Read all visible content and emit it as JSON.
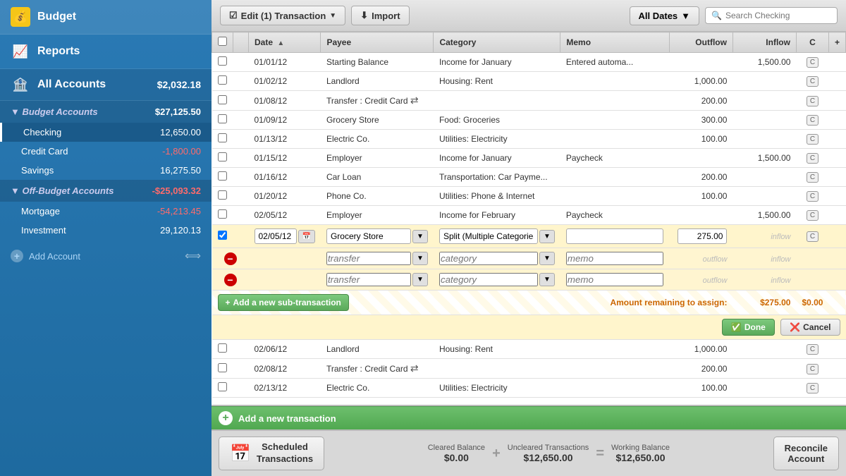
{
  "sidebar": {
    "budget_label": "Budget",
    "reports_label": "Reports",
    "all_accounts_label": "All Accounts",
    "all_accounts_balance": "$2,032.18",
    "budget_accounts_label": "Budget Accounts",
    "budget_accounts_balance": "$27,125.50",
    "off_budget_label": "Off-Budget Accounts",
    "off_budget_balance": "-$25,093.32",
    "accounts": [
      {
        "name": "Checking",
        "balance": "12,650.00",
        "active": true,
        "negative": false
      },
      {
        "name": "Credit Card",
        "balance": "-1,800.00",
        "active": false,
        "negative": true
      },
      {
        "name": "Savings",
        "balance": "16,275.50",
        "active": false,
        "negative": false
      }
    ],
    "off_budget_accounts": [
      {
        "name": "Mortgage",
        "balance": "-54,213.45",
        "active": false,
        "negative": true
      },
      {
        "name": "Investment",
        "balance": "29,120.13",
        "active": false,
        "negative": false
      }
    ],
    "add_account_label": "Add Account"
  },
  "toolbar": {
    "edit_transaction_label": "Edit (1) Transaction",
    "import_label": "Import",
    "all_dates_label": "All Dates",
    "search_placeholder": "Search Checking"
  },
  "table": {
    "columns": [
      "",
      "",
      "Date",
      "Payee",
      "Category",
      "Memo",
      "Outflow",
      "Inflow",
      "C",
      "+"
    ],
    "rows": [
      {
        "date": "01/01/12",
        "payee": "Starting Balance",
        "category": "Income for January",
        "memo": "Entered automa...",
        "outflow": "",
        "inflow": "1,500.00",
        "cleared": "C"
      },
      {
        "date": "01/02/12",
        "payee": "Landlord",
        "category": "Housing: Rent",
        "memo": "",
        "outflow": "1,000.00",
        "inflow": "",
        "cleared": "C"
      },
      {
        "date": "01/08/12",
        "payee": "Transfer : Credit Card",
        "category": "",
        "memo": "",
        "outflow": "200.00",
        "inflow": "",
        "cleared": "C",
        "transfer": true
      },
      {
        "date": "01/09/12",
        "payee": "Grocery Store",
        "category": "Food: Groceries",
        "memo": "",
        "outflow": "300.00",
        "inflow": "",
        "cleared": "C"
      },
      {
        "date": "01/13/12",
        "payee": "Electric Co.",
        "category": "Utilities: Electricity",
        "memo": "",
        "outflow": "100.00",
        "inflow": "",
        "cleared": "C"
      },
      {
        "date": "01/15/12",
        "payee": "Employer",
        "category": "Income for January",
        "memo": "Paycheck",
        "outflow": "",
        "inflow": "1,500.00",
        "cleared": "C"
      },
      {
        "date": "01/16/12",
        "payee": "Car Loan",
        "category": "Transportation: Car Payme...",
        "memo": "",
        "outflow": "200.00",
        "inflow": "",
        "cleared": "C"
      },
      {
        "date": "01/20/12",
        "payee": "Phone Co.",
        "category": "Utilities: Phone & Internet",
        "memo": "",
        "outflow": "100.00",
        "inflow": "",
        "cleared": "C"
      },
      {
        "date": "02/05/12",
        "payee": "Employer",
        "category": "Income for February",
        "memo": "Paycheck",
        "outflow": "",
        "inflow": "1,500.00",
        "cleared": "C"
      }
    ],
    "editing_row": {
      "date": "02/05/12",
      "payee": "Grocery Store",
      "category": "Split (Multiple Categories)",
      "memo": "",
      "outflow": "275.00",
      "inflow": "inflow"
    },
    "sub_transactions": [
      {
        "transfer": "transfer",
        "category": "category",
        "memo": "memo",
        "outflow": "outflow",
        "inflow": "inflow"
      },
      {
        "transfer": "transfer",
        "category": "category",
        "memo": "memo",
        "outflow": "outflow",
        "inflow": "inflow"
      }
    ],
    "amount_remaining_label": "Amount remaining to assign:",
    "amount_remaining_outflow": "$275.00",
    "amount_remaining_inflow": "$0.00",
    "add_sub_label": "Add a new sub-transaction",
    "done_label": "Done",
    "cancel_label": "Cancel",
    "post_rows": [
      {
        "date": "02/06/12",
        "payee": "Landlord",
        "category": "Housing: Rent",
        "memo": "",
        "outflow": "1,000.00",
        "inflow": "",
        "cleared": "C"
      },
      {
        "date": "02/08/12",
        "payee": "Transfer : Credit Card",
        "category": "",
        "memo": "",
        "outflow": "200.00",
        "inflow": "",
        "cleared": "C",
        "transfer": true
      },
      {
        "date": "02/13/12",
        "payee": "Electric Co.",
        "category": "Utilities: Electricity",
        "memo": "",
        "outflow": "100.00",
        "inflow": "",
        "cleared": "C"
      }
    ]
  },
  "add_transaction": {
    "label": "Add a new transaction"
  },
  "footer": {
    "scheduled_label_line1": "Scheduled",
    "scheduled_label_line2": "Transactions",
    "cleared_balance_label": "Cleared Balance",
    "cleared_balance_value": "$0.00",
    "uncleared_label": "Uncleared Transactions",
    "uncleared_value": "$12,650.00",
    "working_balance_label": "Working Balance",
    "working_balance_value": "$12,650.00",
    "reconcile_label": "Reconcile\nAccount"
  }
}
